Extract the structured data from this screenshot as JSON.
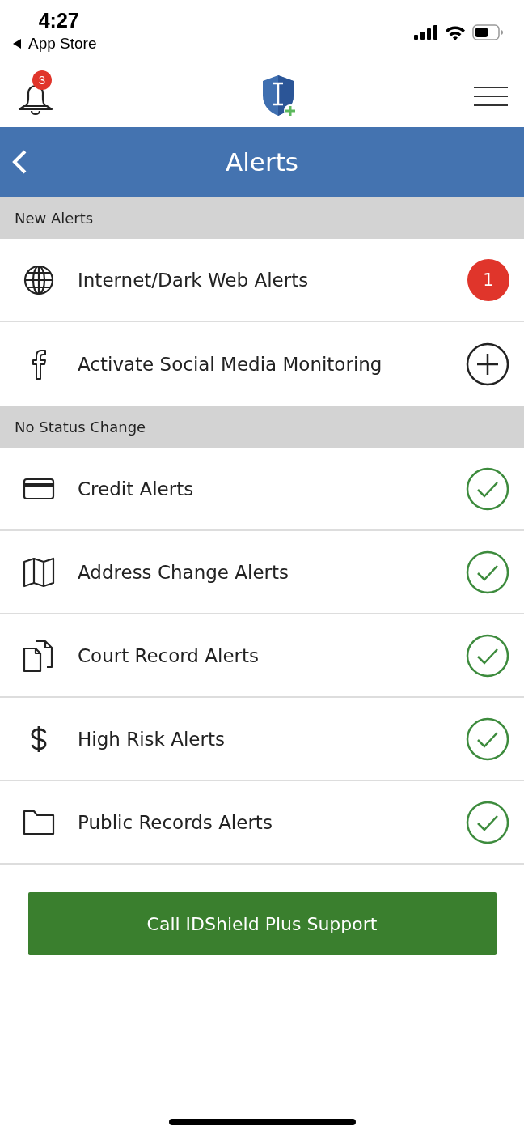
{
  "status_bar": {
    "time": "4:27",
    "back_label": "App Store"
  },
  "header": {
    "notification_count": "3"
  },
  "title_bar": {
    "title": "Alerts"
  },
  "sections": [
    {
      "title": "New Alerts",
      "items": [
        {
          "label": "Internet/Dark Web Alerts",
          "kind": "count",
          "badge": "1"
        },
        {
          "label": "Activate Social Media Monitoring",
          "kind": "activate"
        }
      ]
    },
    {
      "title": "No Status Change",
      "items": [
        {
          "label": "Credit Alerts",
          "kind": "status"
        },
        {
          "label": "Address Change Alerts",
          "kind": "status"
        },
        {
          "label": "Court Record Alerts",
          "kind": "status"
        },
        {
          "label": "High Risk Alerts",
          "kind": "status"
        },
        {
          "label": "Public Records Alerts",
          "kind": "status"
        }
      ]
    }
  ],
  "support_button": {
    "label": "Call IDShield Plus Support"
  }
}
